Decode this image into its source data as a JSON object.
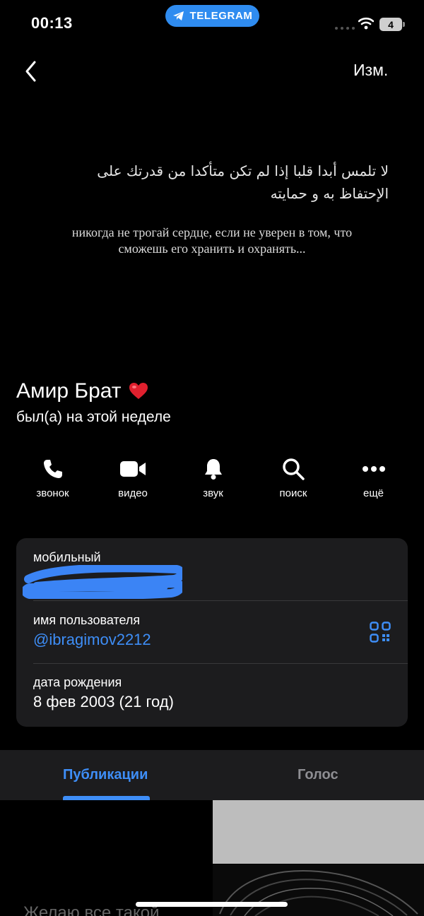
{
  "status_bar": {
    "time": "00:13",
    "app_pill": "TELEGRAM",
    "battery": "4"
  },
  "nav": {
    "edit": "Изм."
  },
  "cover": {
    "arabic_line1": "لا تلمس أبدا قلبا إذا لم تكن متأكدا من قدرتك على",
    "arabic_line2": "الإحتفاظ به و حمايته",
    "russian_line1": "никогда не трогай сердце, если не уверен в том, что",
    "russian_line2": "сможешь его хранить и охранять..."
  },
  "profile": {
    "name": "Амир Брат",
    "status": "был(а) на этой неделе"
  },
  "actions": [
    {
      "label": "звонок",
      "icon": "phone-icon"
    },
    {
      "label": "видео",
      "icon": "video-icon"
    },
    {
      "label": "звук",
      "icon": "bell-icon"
    },
    {
      "label": "поиск",
      "icon": "search-icon"
    },
    {
      "label": "ещё",
      "icon": "more-icon"
    }
  ],
  "info": {
    "phone_label": "мобильный",
    "username_label": "имя пользователя",
    "username": "@ibragimov2212",
    "birthday_label": "дата рождения",
    "birthday": "8 фев 2003 (21 год)"
  },
  "tabs": [
    {
      "label": "Публикации",
      "active": true
    },
    {
      "label": "Голос",
      "active": false
    }
  ],
  "media": {
    "caption": "Желаю все такой"
  },
  "colors": {
    "accent": "#3e8ef7",
    "card": "#1c1c1e",
    "telegram": "#2f8cf0",
    "redaction": "#3b84f5"
  }
}
